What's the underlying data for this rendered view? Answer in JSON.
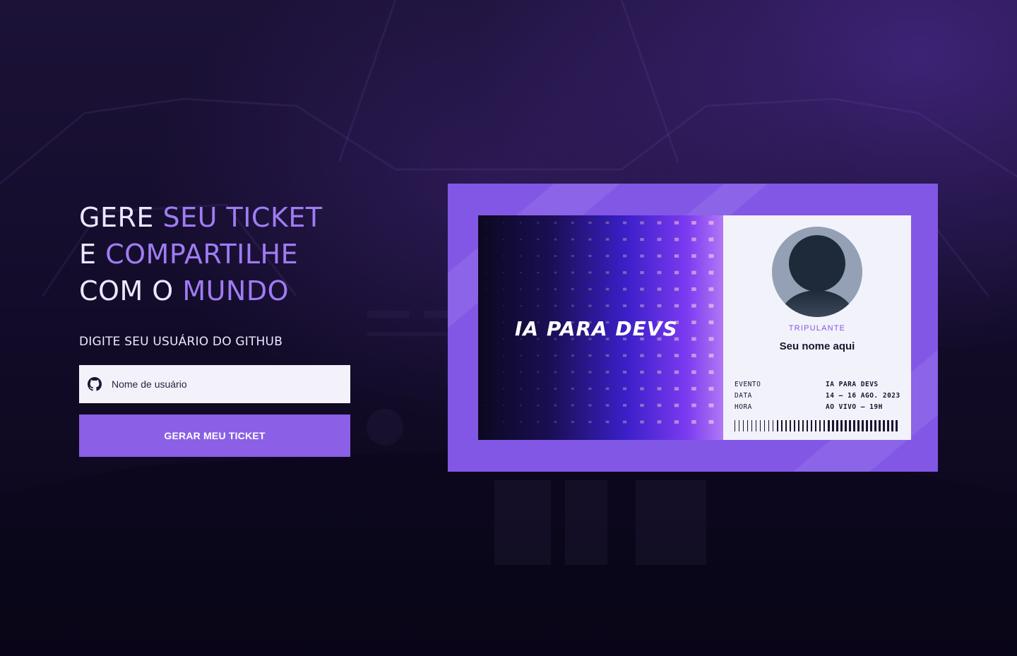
{
  "hero": {
    "line1_white": "GERE",
    "line1_accent": "SEU TICKET",
    "line2_white": "E",
    "line2_accent": "COMPARTILHE",
    "line3_white": "COM O",
    "line3_accent": "MUNDO"
  },
  "form": {
    "label": "DIGITE SEU USUÁRIO DO GITHUB",
    "username_placeholder": "Nome de usuário",
    "username_value": "",
    "submit_label": "GERAR MEU TICKET"
  },
  "ticket": {
    "brand": "IA PARA DEVS",
    "role": "TRIPULANTE",
    "name": "Seu nome aqui",
    "details": [
      {
        "key": "EVENTO",
        "value": "IA PARA DEVS"
      },
      {
        "key": "DATA",
        "value": "14 — 16 AGO. 2023"
      },
      {
        "key": "HORA",
        "value": "AO VIVO — 19H"
      }
    ]
  },
  "icons": {
    "input_icon": "github-icon",
    "avatar_icon": "user-silhouette-icon"
  },
  "colors": {
    "accent": "#8257e5",
    "button": "#8b5fe6",
    "headline_accent": "#9f7cf3",
    "input_bg": "#f3f2fb",
    "page_bg": "#130c2a"
  }
}
